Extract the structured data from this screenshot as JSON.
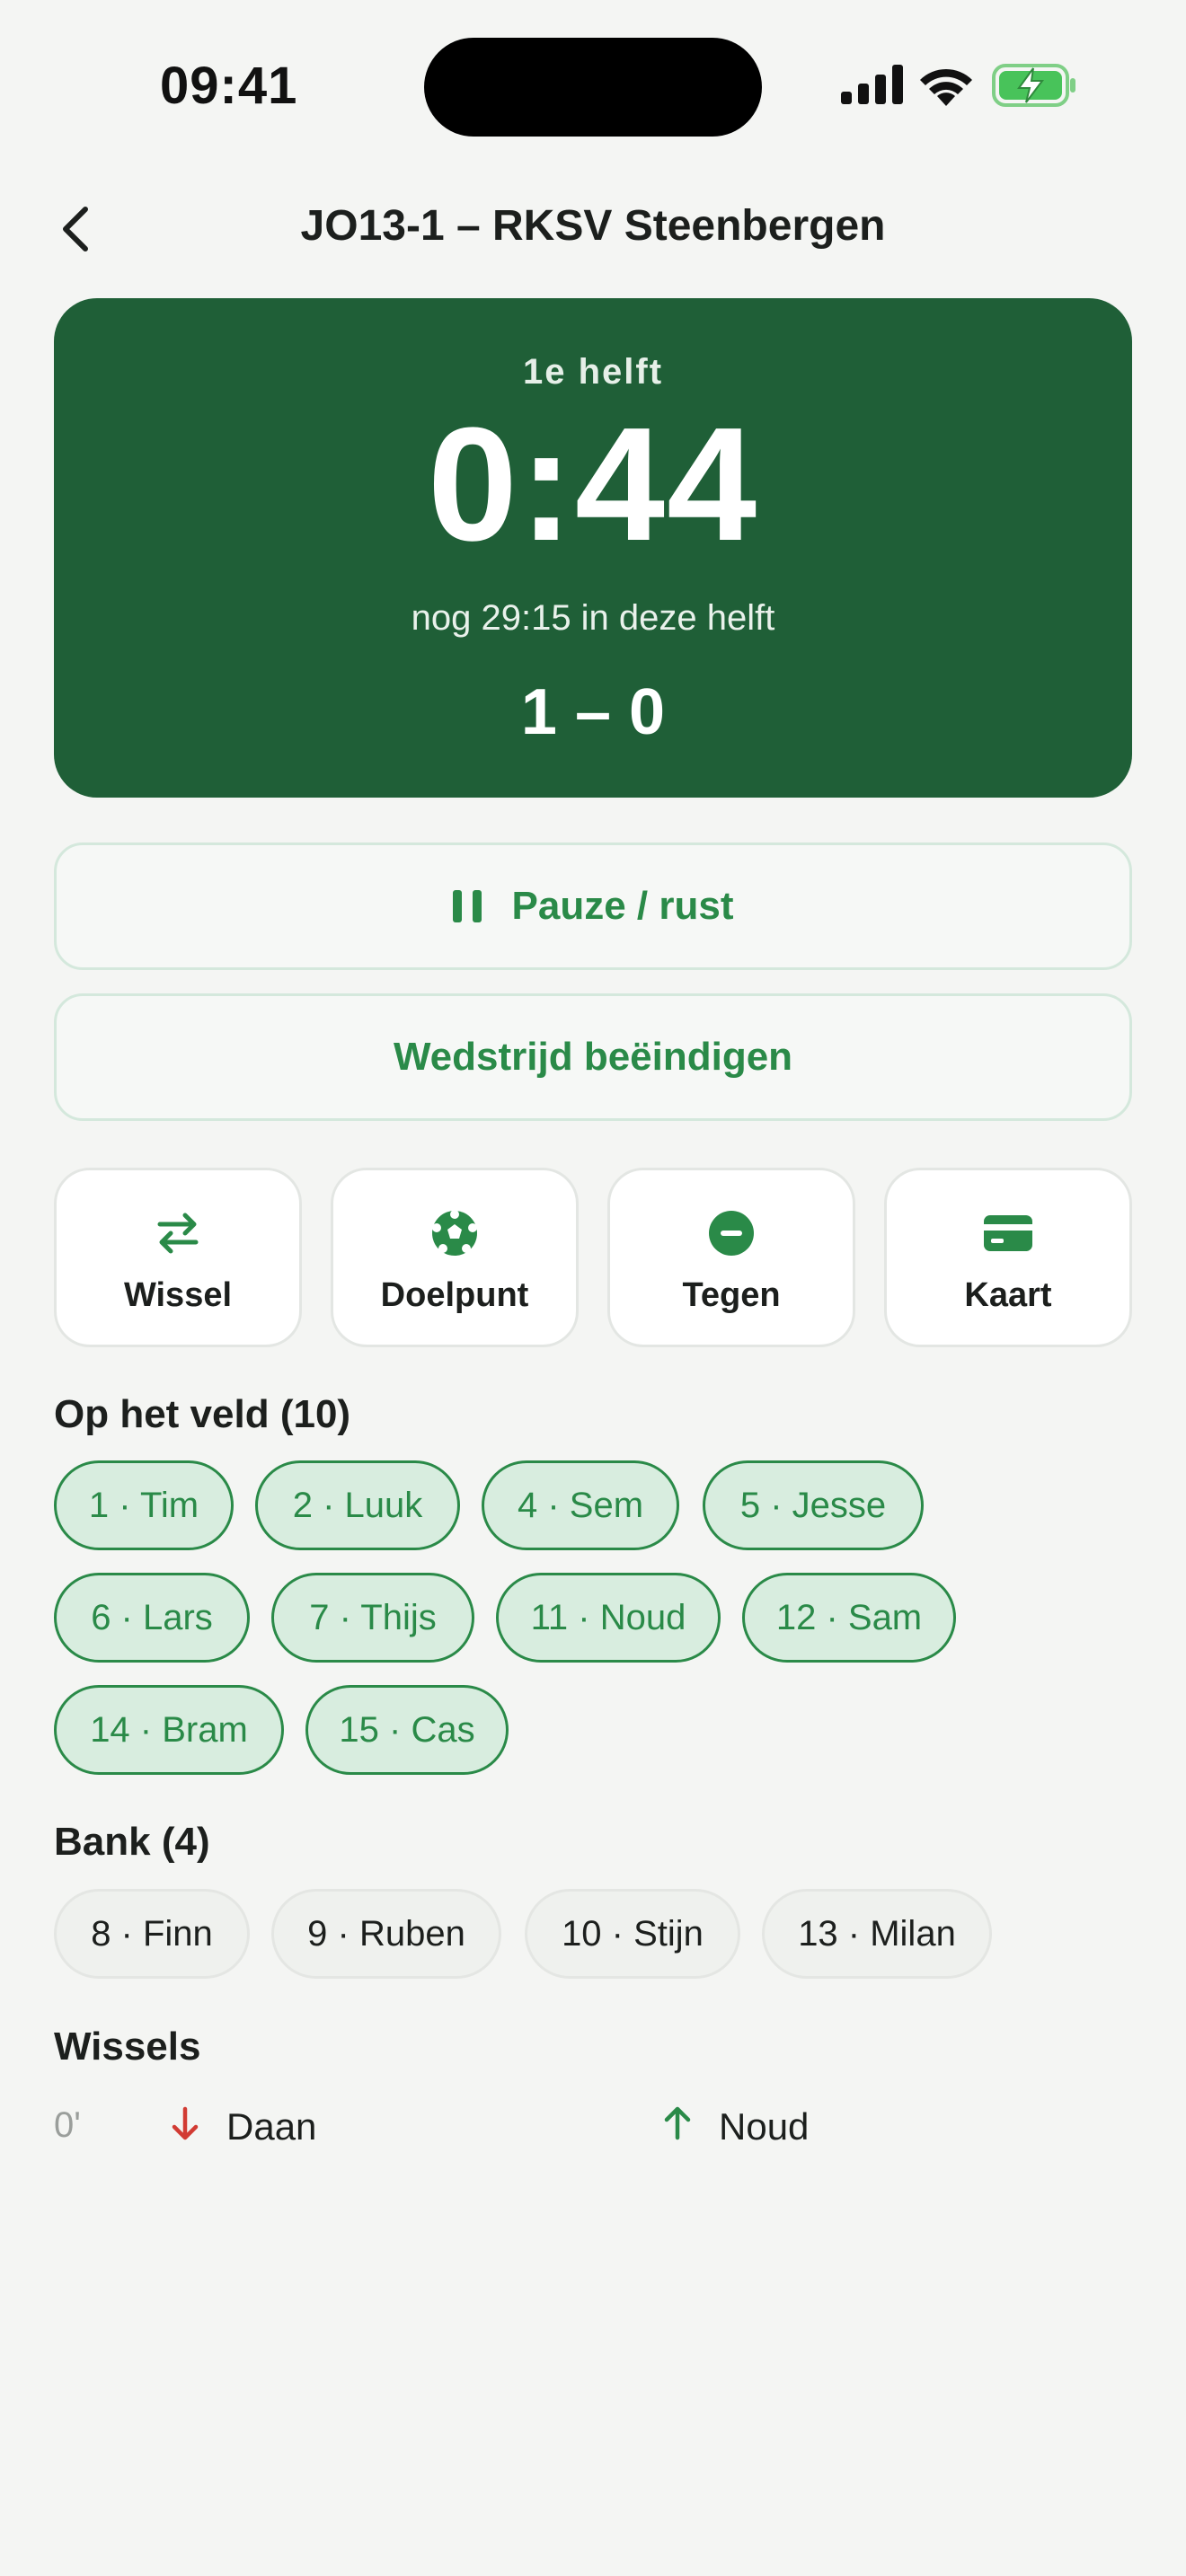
{
  "status_bar": {
    "time": "09:41"
  },
  "header": {
    "title": "JO13-1 – RKSV Steenbergen",
    "back_icon": "chevron-left-icon"
  },
  "scoreboard": {
    "period": "1e helft",
    "clock": "0:44",
    "remaining": "nog 29:15 in deze helft",
    "score": "1 – 0",
    "background": "#1f5f37"
  },
  "buttons": {
    "pause_label": "Pauze / rust",
    "end_label": "Wedstrijd beëindigen"
  },
  "actions": [
    {
      "label": "Wissel",
      "icon": "swap-icon"
    },
    {
      "label": "Doelpunt",
      "icon": "soccer-ball-icon"
    },
    {
      "label": "Tegen",
      "icon": "minus-circle-icon"
    },
    {
      "label": "Kaart",
      "icon": "card-icon"
    }
  ],
  "on_field": {
    "title": "Op het veld (10)",
    "players": [
      "1 · Tim",
      "2 · Luuk",
      "4 · Sem",
      "5 · Jesse",
      "6 · Lars",
      "7 · Thijs",
      "11 · Noud",
      "12 · Sam",
      "14 · Bram",
      "15 · Cas"
    ]
  },
  "bench": {
    "title": "Bank (4)",
    "players": [
      "8 · Finn",
      "9 · Ruben",
      "10 · Stijn",
      "13 · Milan"
    ]
  },
  "substitutions": {
    "title": "Wissels",
    "items": [
      {
        "minute": "0'",
        "out": "Daan",
        "in": "Noud"
      }
    ]
  },
  "colors": {
    "accent": "#2a8a48",
    "out_arrow": "#d23b33",
    "background": "#f4f5f3"
  }
}
